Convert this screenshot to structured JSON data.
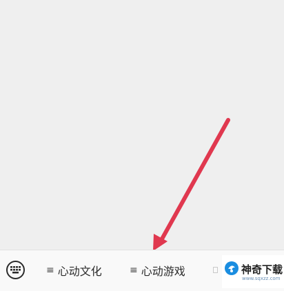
{
  "bottom_bar": {
    "keyboard_button": {
      "icon": "keyboard-icon"
    },
    "menu_items": [
      {
        "prefix": "≡",
        "label": "心动文化"
      },
      {
        "prefix": "≡",
        "label": "心动游戏"
      }
    ]
  },
  "watermark": {
    "title": "神奇下载",
    "url": "www.sqxzz.com",
    "logo_color": "#1a8de0"
  },
  "annotation": {
    "arrow_color": "#e0384f"
  }
}
